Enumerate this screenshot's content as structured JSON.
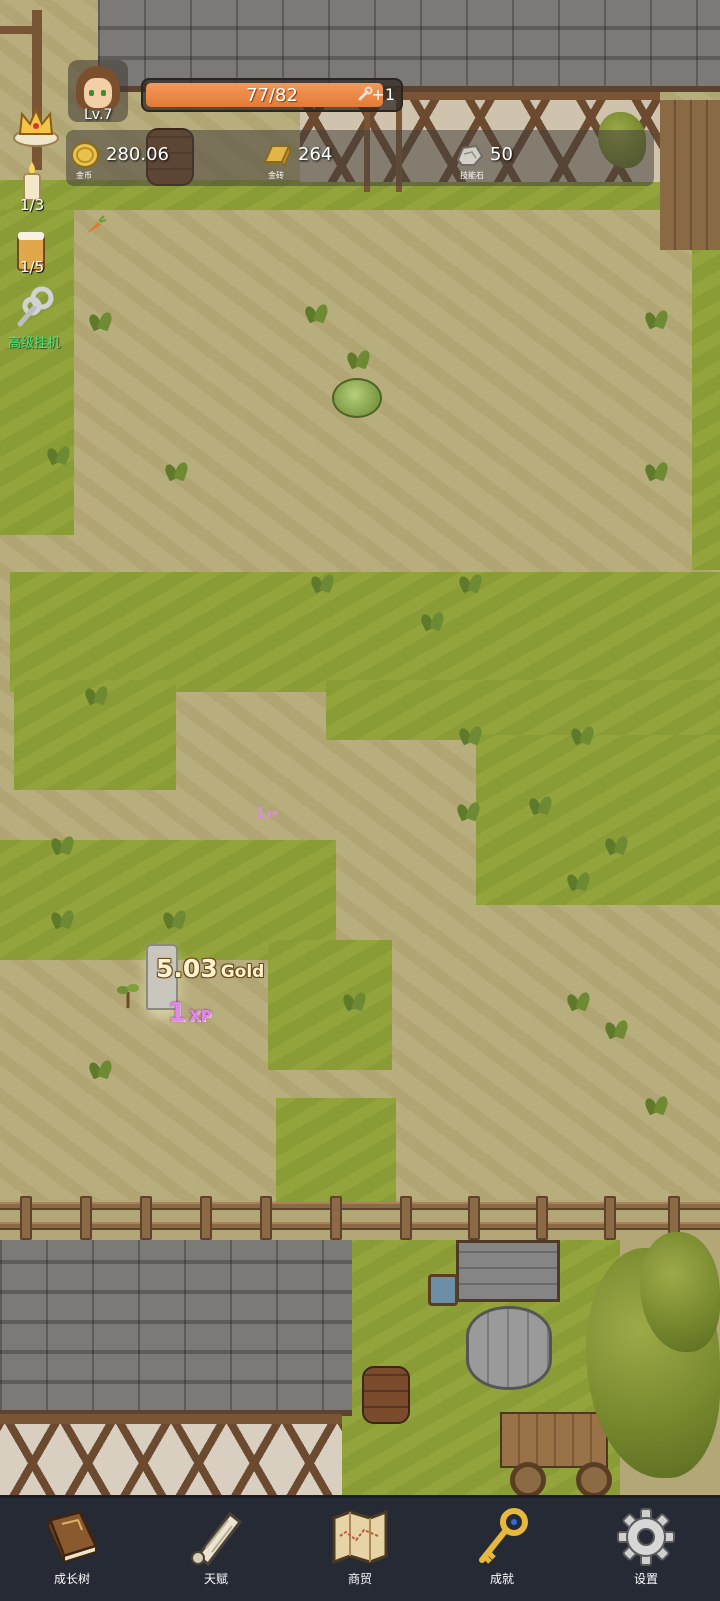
{
  "player": {
    "level": "Lv.7",
    "hp": "77/82",
    "hp_fraction": 0.939,
    "regen": "+1"
  },
  "currencies": [
    {
      "icon": "gold-coin-icon",
      "value": "280.06",
      "label": "金币"
    },
    {
      "icon": "gold-brick-icon",
      "value": "264",
      "label": "金砖"
    },
    {
      "icon": "skill-stone-icon",
      "value": "50",
      "label": "技能石"
    }
  ],
  "side": {
    "candle_count": "1/3",
    "beer_count": "1/5",
    "idle_label": "高级挂机"
  },
  "floating": {
    "gold_amount": "5.03",
    "gold_unit": "Gold",
    "xp_amount": "1",
    "xp_unit": "XP",
    "xp_small_amount": "1",
    "xp_small_unit": "XP"
  },
  "nav": [
    {
      "icon": "book-icon",
      "label": "成长树"
    },
    {
      "icon": "scroll-icon",
      "label": "天赋"
    },
    {
      "icon": "map-icon",
      "label": "商贸"
    },
    {
      "icon": "key-icon",
      "label": "成就"
    },
    {
      "icon": "gear-icon",
      "label": "设置"
    }
  ],
  "colors": {
    "hp_fill": "#e47a36",
    "nav_bg": "#262a35",
    "idle_text": "#4ce87a",
    "xp_text": "#e486e8"
  }
}
